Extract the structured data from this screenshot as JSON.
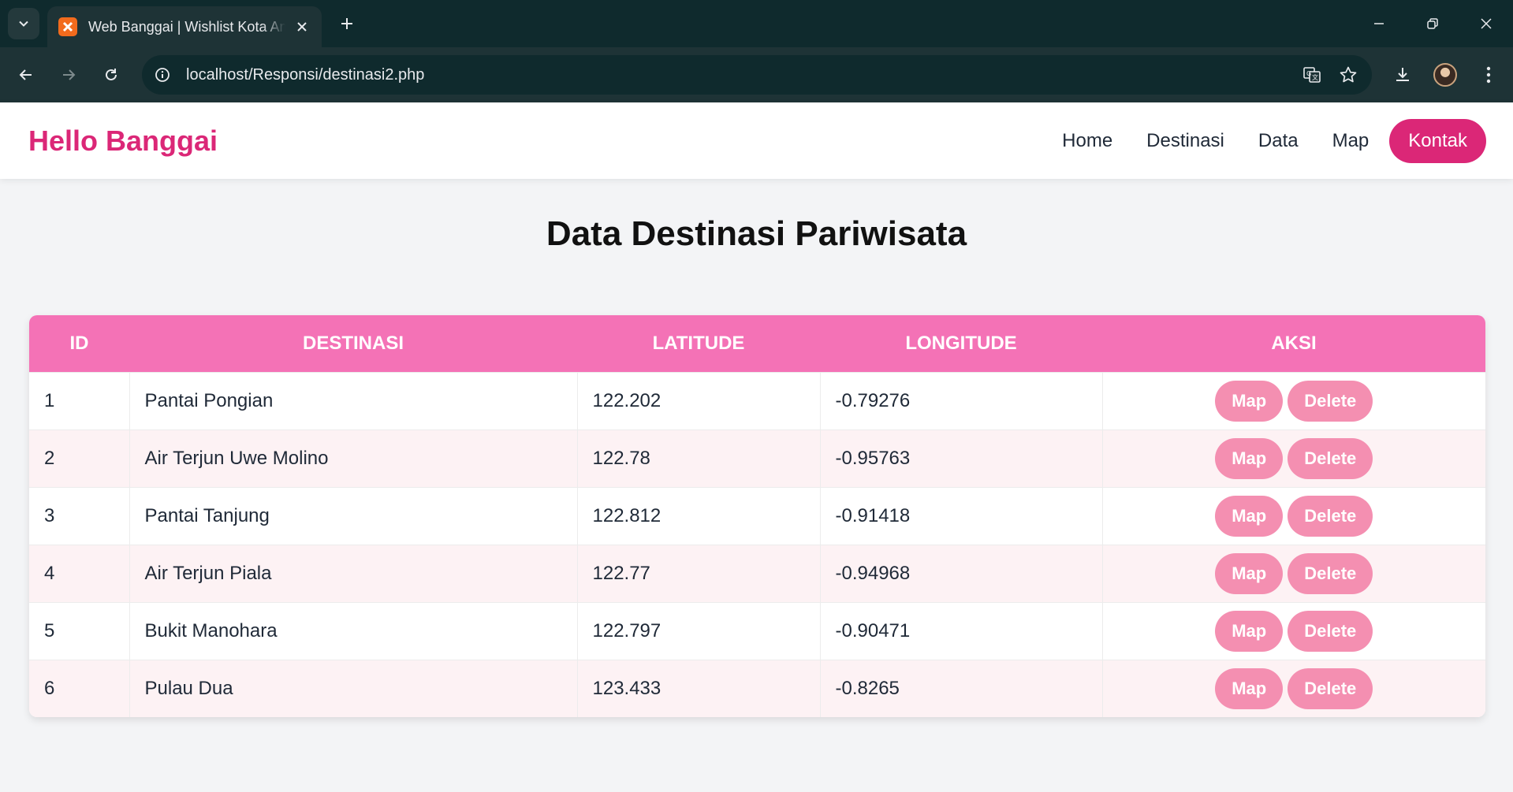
{
  "browser": {
    "tab_title": "Web Banggai | Wishlist Kota Amazing",
    "url_host": "localhost",
    "url_path": "/Responsi/destinasi2.php"
  },
  "site": {
    "brand": "Hello Banggai",
    "nav": [
      "Home",
      "Destinasi",
      "Data",
      "Map"
    ],
    "cta": "Kontak",
    "brand_color": "#db2777"
  },
  "main": {
    "title": "Data Destinasi Pariwisata",
    "columns": [
      "ID",
      "DESTINASI",
      "LATITUDE",
      "LONGITUDE",
      "AKSI"
    ],
    "rows": [
      {
        "id": "1",
        "destinasi": "Pantai Pongian",
        "latitude": "122.202",
        "longitude": "-0.79276"
      },
      {
        "id": "2",
        "destinasi": "Air Terjun Uwe Molino",
        "latitude": "122.78",
        "longitude": "-0.95763"
      },
      {
        "id": "3",
        "destinasi": "Pantai Tanjung",
        "latitude": "122.812",
        "longitude": "-0.91418"
      },
      {
        "id": "4",
        "destinasi": "Air Terjun Piala",
        "latitude": "122.77",
        "longitude": "-0.94968"
      },
      {
        "id": "5",
        "destinasi": "Bukit Manohara",
        "latitude": "122.797",
        "longitude": "-0.90471"
      },
      {
        "id": "6",
        "destinasi": "Pulau Dua",
        "latitude": "123.433",
        "longitude": "-0.8265"
      }
    ],
    "actions": {
      "map": "Map",
      "delete": "Delete"
    },
    "header_color": "#f472b6",
    "button_color": "#f48fb1"
  }
}
